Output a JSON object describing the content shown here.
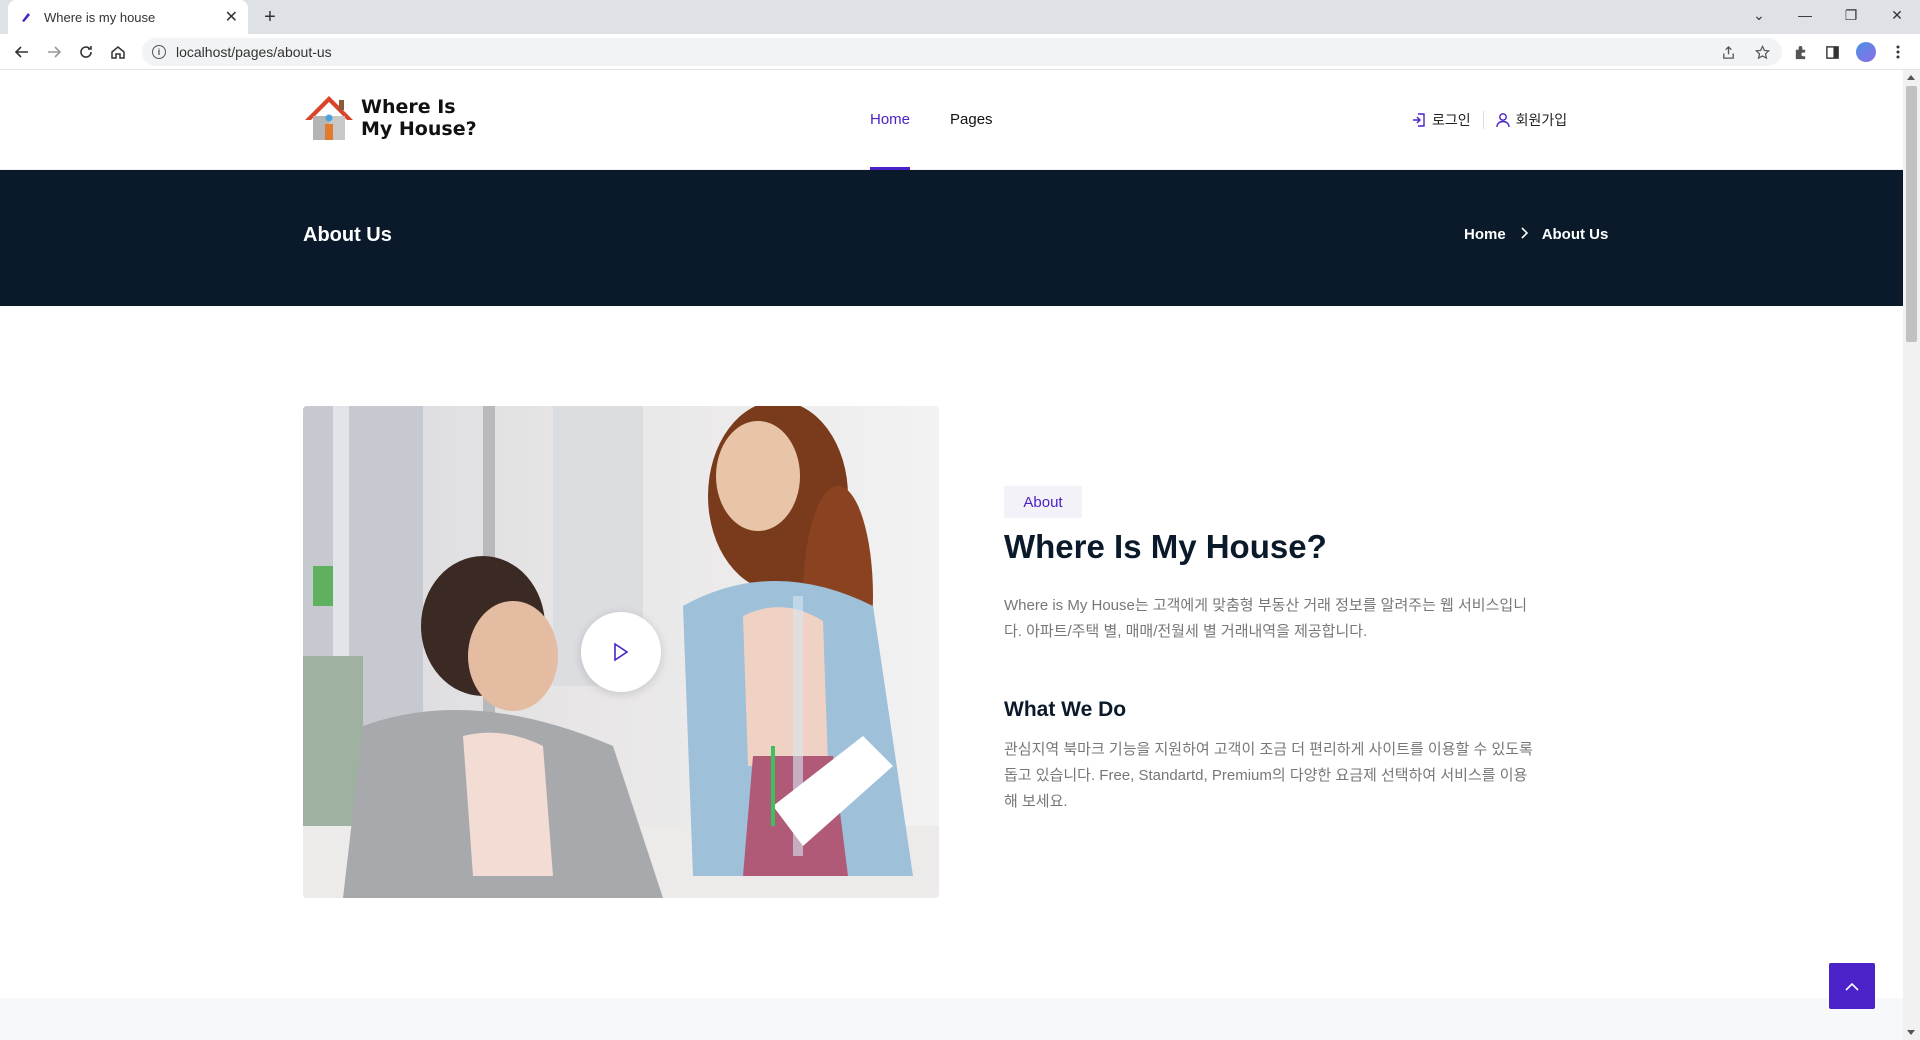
{
  "browser": {
    "tab_title": "Where is my house",
    "tab_close": "✕",
    "new_tab": "+",
    "url": "localhost/pages/about-us",
    "window_controls": [
      "⌄",
      "—",
      "❐",
      "✕"
    ]
  },
  "site": {
    "logo_line1": "Where Is",
    "logo_line2": "My House?",
    "nav": [
      {
        "label": "Home",
        "active": true
      },
      {
        "label": "Pages",
        "active": false
      }
    ],
    "login": "로그인",
    "signup": "회원가입"
  },
  "banner": {
    "title": "About Us",
    "breadcrumb": [
      "Home",
      "About Us"
    ]
  },
  "about": {
    "badge": "About",
    "heading": "Where Is My House?",
    "description": "Where is My House는 고객에게 맞춤형 부동산 거래 정보를 알려주는 웹 서비스입니다. 아파트/주택 별, 매매/전월세 별 거래내역을 제공합니다.",
    "subheading": "What We Do",
    "what_we_do": "관심지역 북마크 기능을 지원하여 고객이 조금 더 편리하게 사이트를 이용할 수 있도록 돕고 있습니다. Free, Standartd, Premium의 다양한 요금제 선택하여 서비스를 이용해 보세요."
  },
  "colors": {
    "accent": "#4a22c8",
    "banner_bg": "#0a1a2a"
  }
}
